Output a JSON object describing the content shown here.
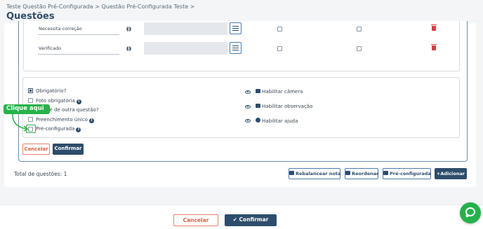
{
  "header": {
    "breadcrumb": "Teste Questão Pré-Configurada > Questão Pré-Configurada Teste >",
    "title": "Questões"
  },
  "fields": [
    {
      "name": "Necessita correção"
    },
    {
      "name": "Verificado"
    }
  ],
  "options": {
    "obrigatorio": "Obrigatório?",
    "foto_obrigatoria": "Foto obrigatória",
    "depende": "de de outra questão?",
    "preenchimento_unico": "Preenchimento único",
    "pre_configurada": "Pré-configurada",
    "habilitar_camera": "Habilitar câmera",
    "habilitar_observacao": "Habilitar observação",
    "habilitar_ajuda": "Habilitar ajuda"
  },
  "callout": "Clique aqui",
  "editor_buttons": {
    "cancel": "Cancelar",
    "confirm": "Confirmar"
  },
  "total_label": "Total de questões: 1",
  "actions": {
    "rebalance": "Rebalancear nota",
    "reorder": "Reordenar",
    "preconfig": "Pré-configurada",
    "add": "Adicionar"
  },
  "footer": {
    "cancel": "Cancelar",
    "confirm": "Confirmar"
  },
  "colors": {
    "primary": "#2e4d6b",
    "cancel": "#d9604a",
    "highlight": "#27b34a",
    "delete": "#d24040"
  },
  "icons": [
    "globe-icon",
    "list-icon",
    "trash-icon",
    "info-icon",
    "eye-icon",
    "camera-icon",
    "note-icon",
    "help-icon",
    "scale-icon",
    "sort-icon",
    "list-icon",
    "plus-icon",
    "check-icon",
    "chat-icon"
  ]
}
